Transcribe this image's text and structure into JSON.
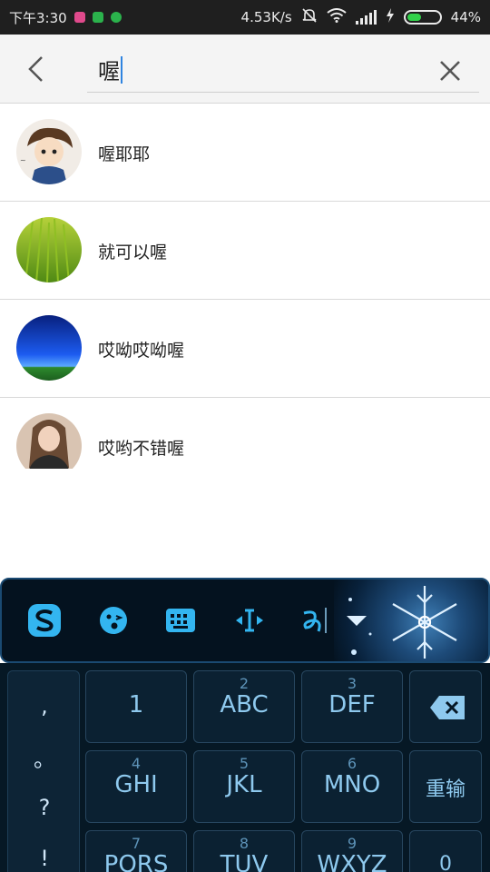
{
  "status_bar": {
    "time": "下午3:30",
    "speed": "4.53K/s",
    "battery_percent": "44%",
    "battery_level": 0.44
  },
  "search": {
    "query": "喔"
  },
  "results": [
    {
      "name": "喔耶耶",
      "avatar": "cartoon-boy-avatar"
    },
    {
      "name": "就可以喔",
      "avatar": "grass-avatar"
    },
    {
      "name": "哎呦哎呦喔",
      "avatar": "blue-sky-avatar"
    },
    {
      "name": "哎哟不错喔",
      "avatar": "girl-photo-avatar"
    }
  ],
  "keyboard": {
    "punctuation": [
      ",",
      "。",
      "?",
      "!"
    ],
    "keys": [
      {
        "num": "",
        "label": "1"
      },
      {
        "num": "2",
        "label": "ABC"
      },
      {
        "num": "3",
        "label": "DEF"
      },
      {
        "num": "4",
        "label": "GHI"
      },
      {
        "num": "5",
        "label": "JKL"
      },
      {
        "num": "6",
        "label": "MNO"
      },
      {
        "num": "7",
        "label": "PQRS"
      },
      {
        "num": "8",
        "label": "TUV"
      },
      {
        "num": "9",
        "label": "WXYZ"
      }
    ],
    "retype_label": "重输",
    "zero_label": "0",
    "toolbar_icons": [
      "sogou-logo-icon",
      "emoji-icon",
      "keyboard-icon",
      "cursor-icon",
      "handwriting-icon",
      "collapse-icon"
    ]
  },
  "colors": {
    "caret": "#2f84e0",
    "battery_fill": "#32d14a",
    "keyboard_text": "#8ec9ee"
  }
}
